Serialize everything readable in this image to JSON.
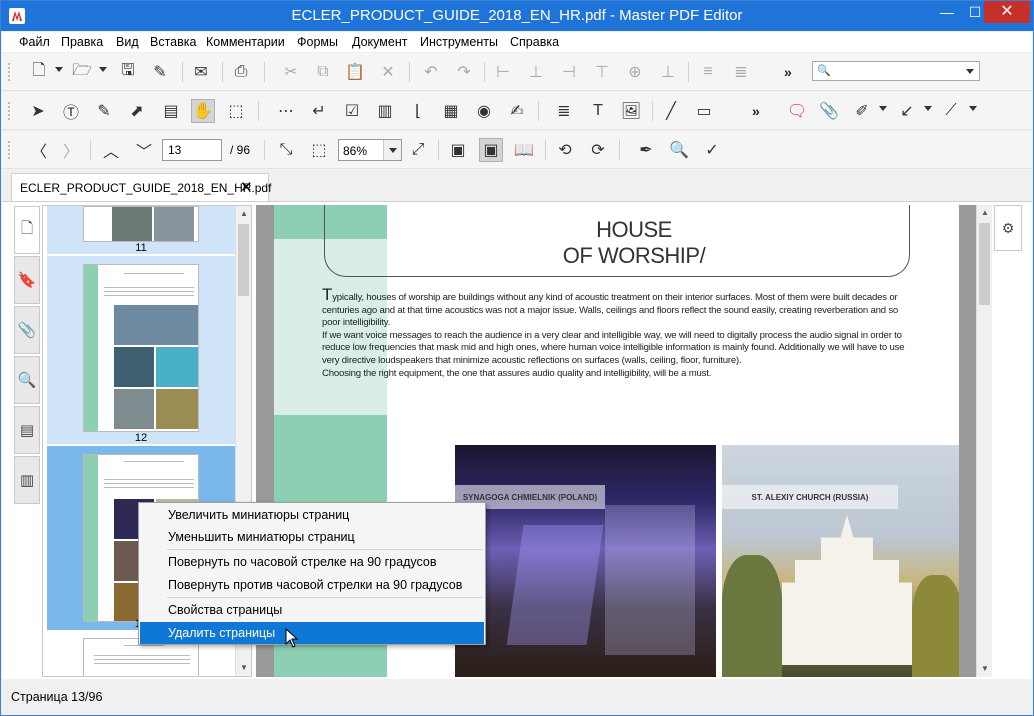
{
  "window": {
    "title": "ECLER_PRODUCT_GUIDE_2018_EN_HR.pdf - Master PDF Editor",
    "min": "—",
    "max": "☐",
    "close": "✕"
  },
  "menu": [
    "Файл",
    "Правка",
    "Вид",
    "Вставка",
    "Комментарии",
    "Формы",
    "Документ",
    "Инструменты",
    "Справка"
  ],
  "nav_toolbar": {
    "page_value": "13",
    "page_total": "/ 96",
    "zoom_value": "86%"
  },
  "tab": {
    "label": "ECLER_PRODUCT_GUIDE_2018_EN_HR.pdf",
    "close": "✕"
  },
  "thumbnails": [
    {
      "num": "11"
    },
    {
      "num": "12"
    },
    {
      "num": "13"
    }
  ],
  "page": {
    "title_line1": "HOUSE",
    "title_line2": "OF WORSHIP/",
    "dropcap": "T",
    "para1": "ypically, houses of worship are buildings without any kind of acoustic treatment on their interior surfaces. Most of them were built decades or centuries ago and at that time acoustics was not a major issue. Walls, ceilings and floors reflect the sound easily, creating reverberation and so poor intelligibility.",
    "para2": "If we want voice messages to reach the audience in a very clear and intelligible way, we will need to digitally process the audio signal in order to reduce low frequencies that mask mid and high ones, where human voice intelligible information is mainly found. Additionally we will have to use very directive loudspeakers that minimize acoustic reflections on surfaces (walls, ceiling, floor, furniture).",
    "para3": " Choosing the right equipment, the one that assures audio quality and intelligibility, will be a must.",
    "caption_left": "SYNAGOGA CHMIELNIK (POLAND)",
    "caption_right": "ST. ALEXIY CHURCH (RUSSIA)"
  },
  "context_menu": {
    "items": [
      "Увеличить миниатюры страниц",
      "Уменьшить миниатюры страниц",
      "Повернуть по часовой стрелке на 90 градусов",
      "Повернуть  против часовой стрелки на 90 градусов",
      "Свойства страницы",
      "Удалить страницы"
    ],
    "highlighted_index": 5
  },
  "status": {
    "text": "Страница 13/96"
  },
  "colors": {
    "titlebar": "#1f74da",
    "highlight": "#0f78d7",
    "page_accent": "#8ccfb3"
  }
}
